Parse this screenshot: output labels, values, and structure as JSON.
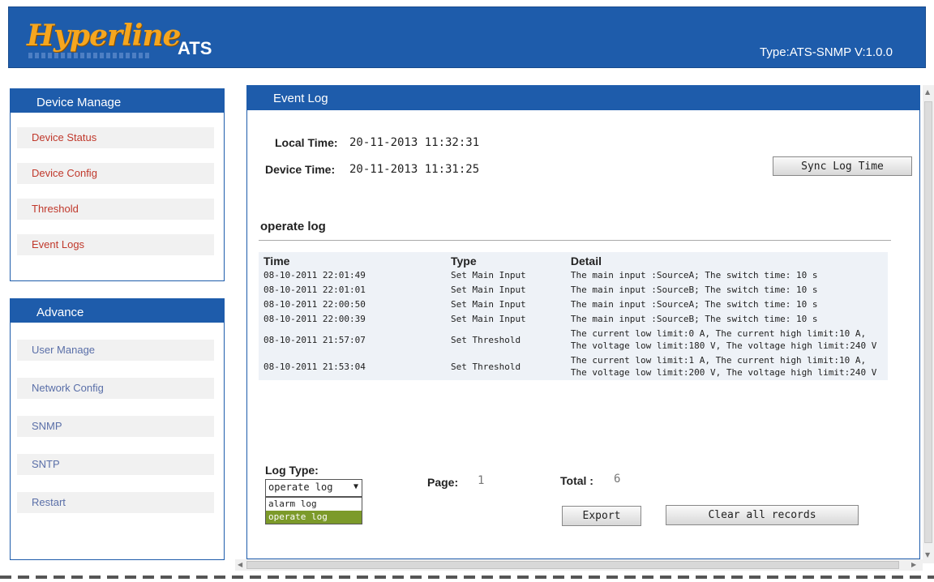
{
  "header": {
    "logo_text": "Hyperline",
    "product": "ATS",
    "version": "Type:ATS-SNMP V:1.0.0"
  },
  "sidebar": {
    "device_manage": {
      "title": "Device Manage",
      "items": [
        {
          "label": "Device Status"
        },
        {
          "label": "Device Config"
        },
        {
          "label": "Threshold"
        },
        {
          "label": "Event Logs"
        }
      ]
    },
    "advance": {
      "title": "Advance",
      "items": [
        {
          "label": "User Manage"
        },
        {
          "label": "Network Config"
        },
        {
          "label": "SNMP"
        },
        {
          "label": "SNTP"
        },
        {
          "label": "Restart"
        }
      ]
    }
  },
  "main": {
    "title": "Event Log",
    "local_time_label": "Local Time:",
    "local_time_value": "20-11-2013 11:32:31",
    "device_time_label": "Device Time:",
    "device_time_value": "20-11-2013 11:31:25",
    "sync_button": "Sync Log Time",
    "section_title": "operate log",
    "columns": [
      "Time",
      "Type",
      "Detail"
    ],
    "rows": [
      {
        "time": "08-10-2011 22:01:49",
        "type": "Set Main Input",
        "detail": "The main input :SourceA; The switch time: 10 s"
      },
      {
        "time": "08-10-2011 22:01:01",
        "type": "Set Main Input",
        "detail": "The main input :SourceB; The switch time: 10 s"
      },
      {
        "time": "08-10-2011 22:00:50",
        "type": "Set Main Input",
        "detail": "The main input :SourceA; The switch time: 10 s"
      },
      {
        "time": "08-10-2011 22:00:39",
        "type": "Set Main Input",
        "detail": "The main input :SourceB; The switch time: 10 s"
      },
      {
        "time": "08-10-2011 21:57:07",
        "type": "Set Threshold",
        "detail": "The current low limit:0 A, The current high limit:10 A, The voltage low limit:180 V, The voltage high limit:240 V"
      },
      {
        "time": "08-10-2011 21:53:04",
        "type": "Set Threshold",
        "detail": "The current low limit:1 A, The current high limit:10 A, The voltage low limit:200 V, The voltage high limit:240 V"
      }
    ],
    "log_type_label": "Log Type:",
    "log_type_selected": "operate log",
    "log_type_options": [
      "alarm log",
      "operate log"
    ],
    "page_label": "Page:",
    "page_value": "1",
    "total_label": "Total :",
    "total_value": "6",
    "export_button": "Export",
    "clear_button": "Clear all records"
  }
}
